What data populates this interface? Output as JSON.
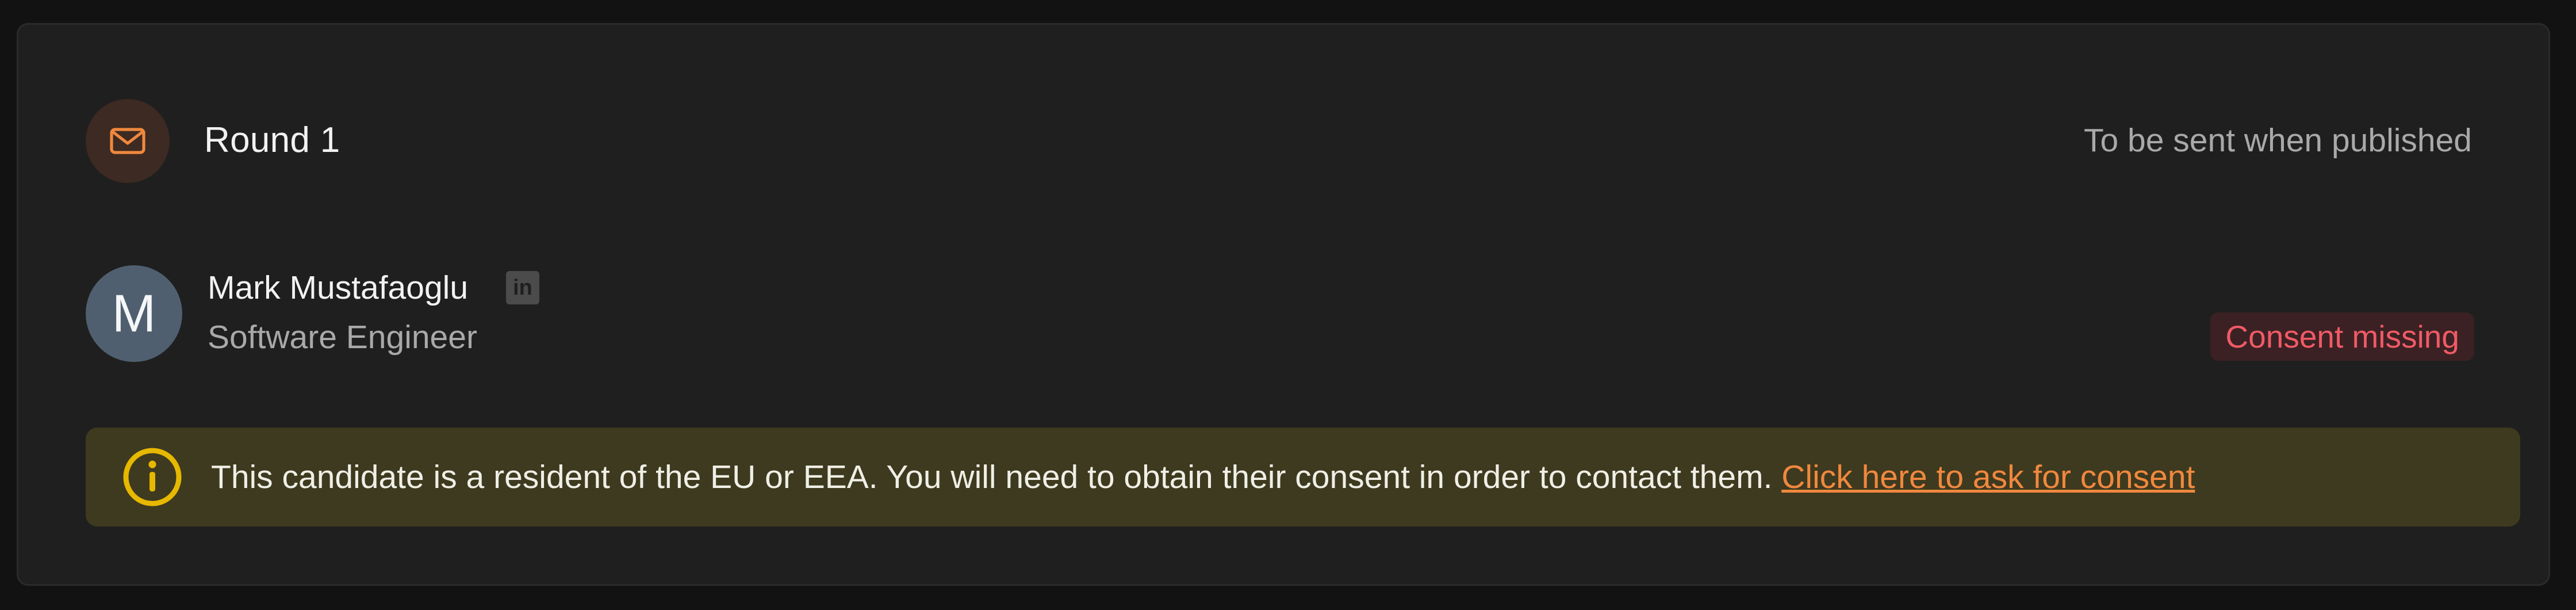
{
  "header": {
    "round_title": "Round 1",
    "schedule_status": "To be sent when published",
    "icon": "mail-icon"
  },
  "candidate": {
    "avatar_initial": "M",
    "name": "Mark Mustafaoglu",
    "title": "Software Engineer",
    "profile_icon": "linkedin-icon",
    "consent_badge": "Consent missing"
  },
  "notice": {
    "icon": "info-icon",
    "message": "This candidate is a resident of the EU or EEA. You will need to obtain their consent in order to contact them. ",
    "link_label": "Click here to ask for consent"
  },
  "colors": {
    "accent_orange": "#f0883e",
    "warning_yellow": "#e6b800",
    "consent_red": "#f05a66",
    "card_background": "#1f1f1f"
  }
}
